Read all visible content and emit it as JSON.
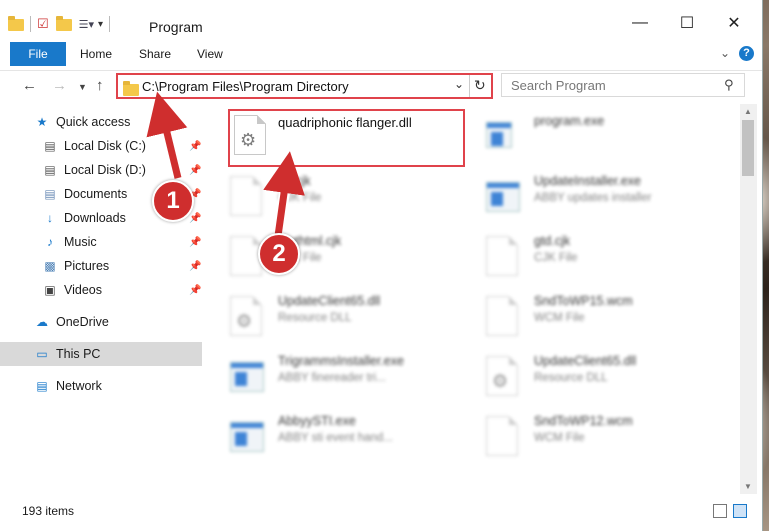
{
  "window": {
    "title": "Program"
  },
  "ribbon": {
    "file": "File",
    "home": "Home",
    "share": "Share",
    "view": "View",
    "help": "?"
  },
  "address": {
    "path": "C:\\Program Files\\Program Directory"
  },
  "search": {
    "placeholder": "Search Program"
  },
  "sidebar": {
    "items": [
      {
        "label": "Quick access",
        "icon": "star-icon"
      },
      {
        "label": "Local Disk (C:)",
        "icon": "drive-icon"
      },
      {
        "label": "Local Disk (D:)",
        "icon": "drive-icon"
      },
      {
        "label": "Documents",
        "icon": "documents-icon"
      },
      {
        "label": "Downloads",
        "icon": "download-icon"
      },
      {
        "label": "Music",
        "icon": "music-icon"
      },
      {
        "label": "Pictures",
        "icon": "pictures-icon"
      },
      {
        "label": "Videos",
        "icon": "videos-icon"
      },
      {
        "label": "OneDrive",
        "icon": "cloud-icon"
      },
      {
        "label": "This PC",
        "icon": "computer-icon"
      },
      {
        "label": "Network",
        "icon": "network-icon"
      }
    ]
  },
  "files": [
    {
      "name": "quadriphonic flanger.dll",
      "type": ""
    },
    {
      "name": "program.exe",
      "type": ""
    },
    {
      "name": "...t.cjk",
      "type": "CJK File"
    },
    {
      "name": "UpdateInstaller.exe",
      "type": "ABBY updates installer"
    },
    {
      "name": "...uthtml.cjk",
      "type": "CJK File"
    },
    {
      "name": "gtd.cjk",
      "type": "CJK File"
    },
    {
      "name": "UpdateClient65.dll",
      "type": "Resource DLL"
    },
    {
      "name": "SndToWP15.wcm",
      "type": "WCM File"
    },
    {
      "name": "TrigrammsInstaller.exe",
      "type": "ABBY finereader tri..."
    },
    {
      "name": "UpdateClient65.dll",
      "type": "Resource DLL"
    },
    {
      "name": "AbbyySTI.exe",
      "type": "ABBY sti event hand..."
    },
    {
      "name": "SndToWP12.wcm",
      "type": "WCM File"
    }
  ],
  "status": {
    "count": "193 items"
  },
  "callouts": {
    "one": "1",
    "two": "2"
  },
  "colors": {
    "accent": "#1979ca",
    "highlight": "#e0434b",
    "callout": "#cf2e2e"
  }
}
